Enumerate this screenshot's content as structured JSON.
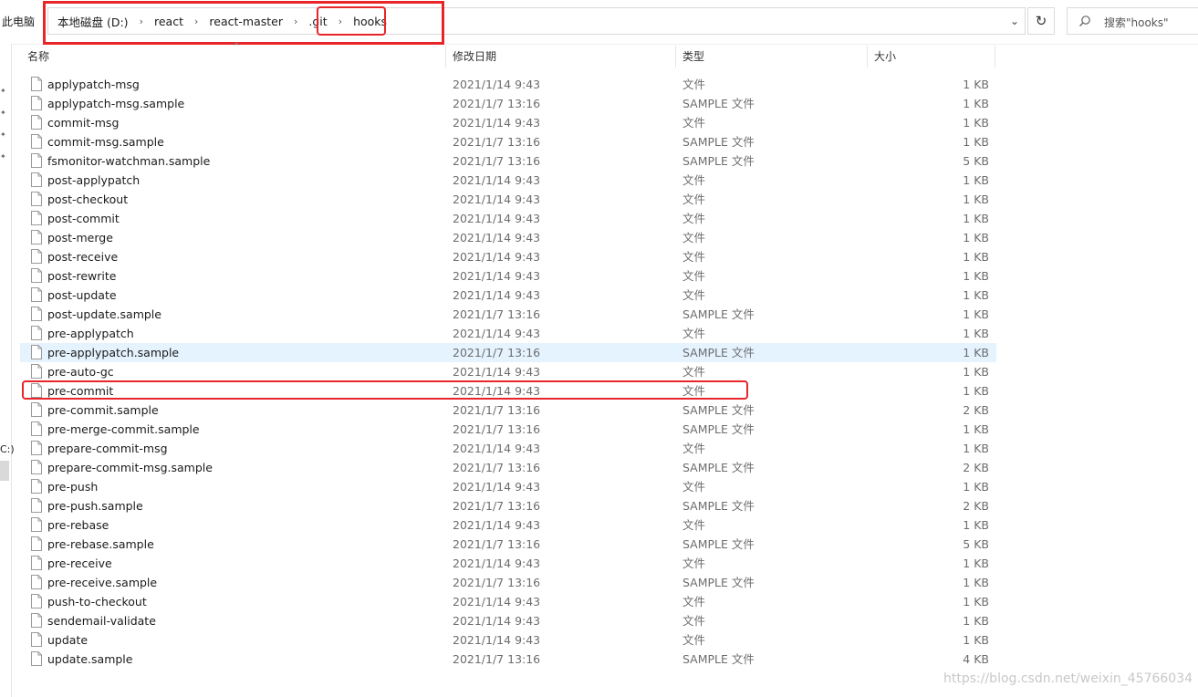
{
  "address": {
    "root_label": "此电脑",
    "crumbs": [
      "本地磁盘 (D:)",
      "react",
      "react-master",
      ".git",
      "hooks"
    ],
    "separator": "›",
    "dropdown_glyph": "⌄",
    "refresh_glyph": "↻"
  },
  "search": {
    "placeholder": "搜索\"hooks\""
  },
  "nav": {
    "drive_fragment": "C:)"
  },
  "columns": {
    "name": "名称",
    "date": "修改日期",
    "type": "类型",
    "size": "大小",
    "sort_glyph": "^"
  },
  "files": [
    {
      "name": "applypatch-msg",
      "date": "2021/1/14 9:43",
      "type": "文件",
      "size": "1 KB"
    },
    {
      "name": "applypatch-msg.sample",
      "date": "2021/1/7 13:16",
      "type": "SAMPLE 文件",
      "size": "1 KB"
    },
    {
      "name": "commit-msg",
      "date": "2021/1/14 9:43",
      "type": "文件",
      "size": "1 KB"
    },
    {
      "name": "commit-msg.sample",
      "date": "2021/1/7 13:16",
      "type": "SAMPLE 文件",
      "size": "1 KB"
    },
    {
      "name": "fsmonitor-watchman.sample",
      "date": "2021/1/7 13:16",
      "type": "SAMPLE 文件",
      "size": "5 KB"
    },
    {
      "name": "post-applypatch",
      "date": "2021/1/14 9:43",
      "type": "文件",
      "size": "1 KB"
    },
    {
      "name": "post-checkout",
      "date": "2021/1/14 9:43",
      "type": "文件",
      "size": "1 KB"
    },
    {
      "name": "post-commit",
      "date": "2021/1/14 9:43",
      "type": "文件",
      "size": "1 KB"
    },
    {
      "name": "post-merge",
      "date": "2021/1/14 9:43",
      "type": "文件",
      "size": "1 KB"
    },
    {
      "name": "post-receive",
      "date": "2021/1/14 9:43",
      "type": "文件",
      "size": "1 KB"
    },
    {
      "name": "post-rewrite",
      "date": "2021/1/14 9:43",
      "type": "文件",
      "size": "1 KB"
    },
    {
      "name": "post-update",
      "date": "2021/1/14 9:43",
      "type": "文件",
      "size": "1 KB"
    },
    {
      "name": "post-update.sample",
      "date": "2021/1/7 13:16",
      "type": "SAMPLE 文件",
      "size": "1 KB"
    },
    {
      "name": "pre-applypatch",
      "date": "2021/1/14 9:43",
      "type": "文件",
      "size": "1 KB"
    },
    {
      "name": "pre-applypatch.sample",
      "date": "2021/1/7 13:16",
      "type": "SAMPLE 文件",
      "size": "1 KB",
      "hover": true
    },
    {
      "name": "pre-auto-gc",
      "date": "2021/1/14 9:43",
      "type": "文件",
      "size": "1 KB"
    },
    {
      "name": "pre-commit",
      "date": "2021/1/14 9:43",
      "type": "文件",
      "size": "1 KB",
      "highlighted": true
    },
    {
      "name": "pre-commit.sample",
      "date": "2021/1/7 13:16",
      "type": "SAMPLE 文件",
      "size": "2 KB"
    },
    {
      "name": "pre-merge-commit.sample",
      "date": "2021/1/7 13:16",
      "type": "SAMPLE 文件",
      "size": "1 KB"
    },
    {
      "name": "prepare-commit-msg",
      "date": "2021/1/14 9:43",
      "type": "文件",
      "size": "1 KB"
    },
    {
      "name": "prepare-commit-msg.sample",
      "date": "2021/1/7 13:16",
      "type": "SAMPLE 文件",
      "size": "2 KB"
    },
    {
      "name": "pre-push",
      "date": "2021/1/14 9:43",
      "type": "文件",
      "size": "1 KB"
    },
    {
      "name": "pre-push.sample",
      "date": "2021/1/7 13:16",
      "type": "SAMPLE 文件",
      "size": "2 KB"
    },
    {
      "name": "pre-rebase",
      "date": "2021/1/14 9:43",
      "type": "文件",
      "size": "1 KB"
    },
    {
      "name": "pre-rebase.sample",
      "date": "2021/1/7 13:16",
      "type": "SAMPLE 文件",
      "size": "5 KB"
    },
    {
      "name": "pre-receive",
      "date": "2021/1/14 9:43",
      "type": "文件",
      "size": "1 KB"
    },
    {
      "name": "pre-receive.sample",
      "date": "2021/1/7 13:16",
      "type": "SAMPLE 文件",
      "size": "1 KB"
    },
    {
      "name": "push-to-checkout",
      "date": "2021/1/14 9:43",
      "type": "文件",
      "size": "1 KB"
    },
    {
      "name": "sendemail-validate",
      "date": "2021/1/14 9:43",
      "type": "文件",
      "size": "1 KB"
    },
    {
      "name": "update",
      "date": "2021/1/14 9:43",
      "type": "文件",
      "size": "1 KB"
    },
    {
      "name": "update.sample",
      "date": "2021/1/7 13:16",
      "type": "SAMPLE 文件",
      "size": "4 KB"
    }
  ],
  "icons": {
    "file": "file-icon",
    "search": "search-icon",
    "refresh": "refresh-icon",
    "chevron": "chevron-down-icon",
    "pin": "pin-icon"
  },
  "colors": {
    "highlight": "#e8262a",
    "hover_row": "#e5f3ff",
    "secondary_text": "#6d6d6d"
  },
  "watermark": "https://blog.csdn.net/weixin_45766034"
}
